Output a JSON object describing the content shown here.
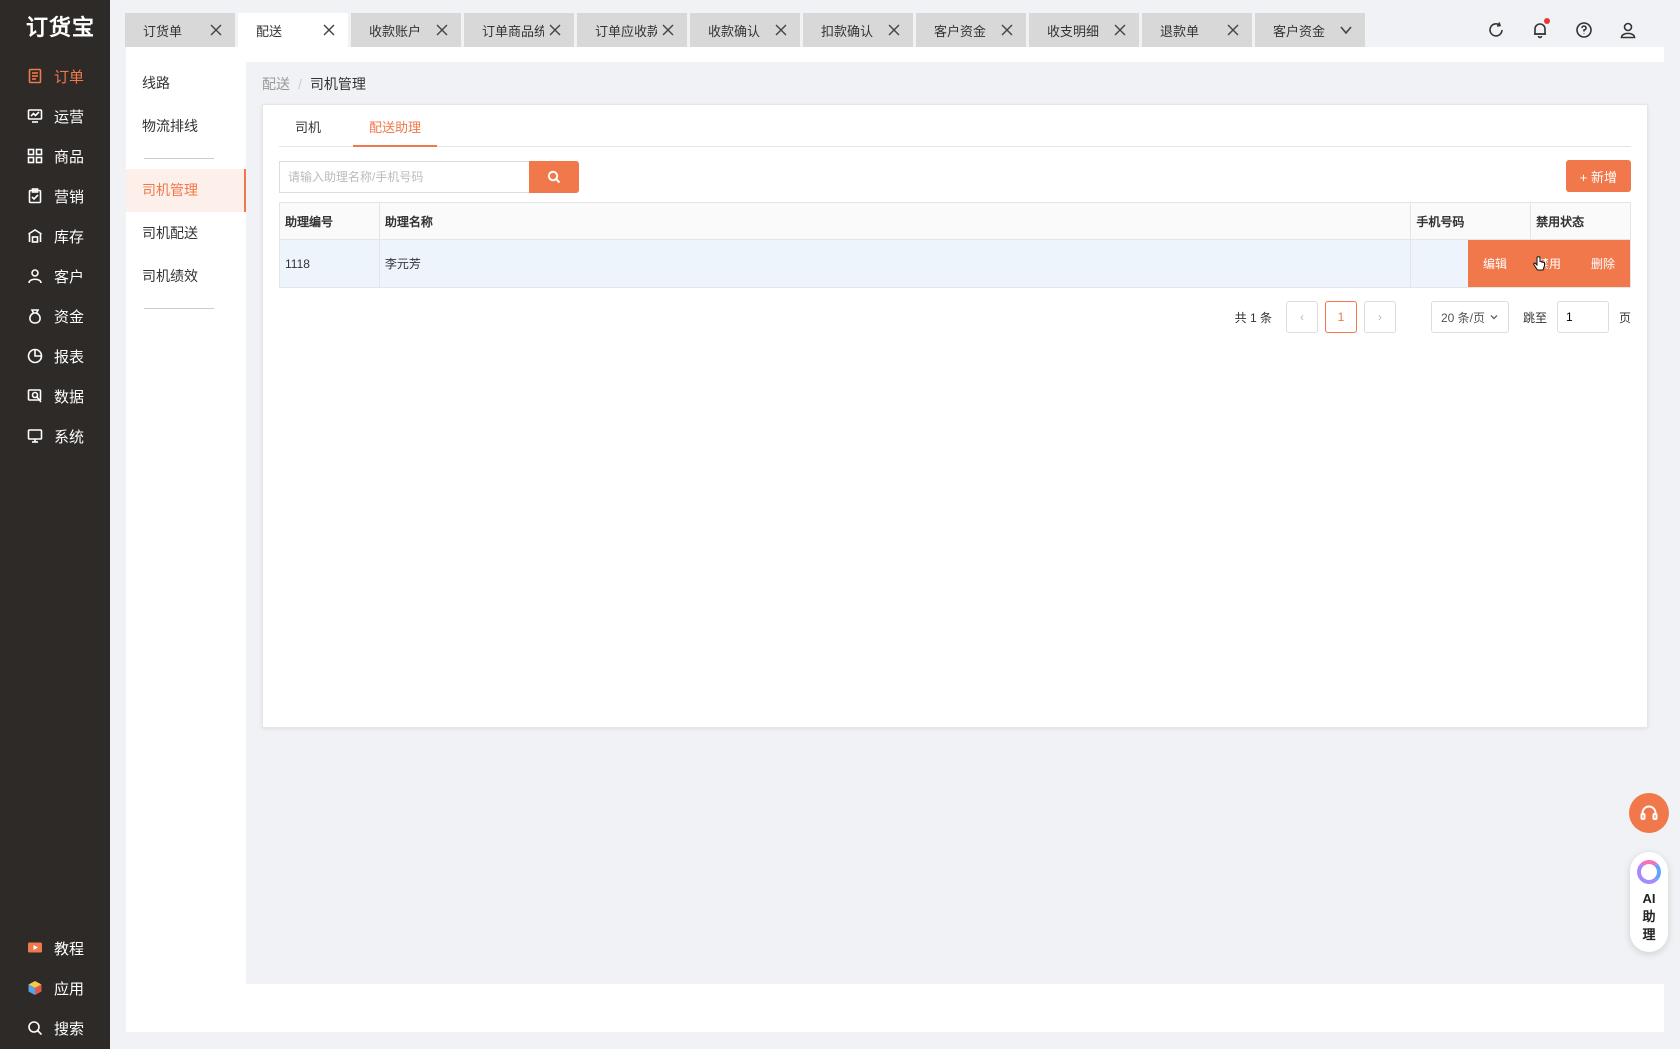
{
  "app": {
    "logo": "订货宝"
  },
  "sidebar": {
    "items": [
      {
        "label": "订单",
        "icon": "order-icon",
        "active": true
      },
      {
        "label": "运营",
        "icon": "operation-icon"
      },
      {
        "label": "商品",
        "icon": "goods-icon"
      },
      {
        "label": "营销",
        "icon": "marketing-icon"
      },
      {
        "label": "库存",
        "icon": "warehouse-icon"
      },
      {
        "label": "客户",
        "icon": "customer-icon"
      },
      {
        "label": "资金",
        "icon": "money-bag-icon"
      },
      {
        "label": "报表",
        "icon": "pie-chart-icon"
      },
      {
        "label": "数据",
        "icon": "data-icon"
      },
      {
        "label": "系统",
        "icon": "monitor-icon"
      }
    ],
    "bottom": [
      {
        "label": "教程",
        "icon": "video-icon"
      },
      {
        "label": "应用",
        "icon": "cube-icon"
      },
      {
        "label": "搜索",
        "icon": "search-icon"
      }
    ]
  },
  "tabs": [
    {
      "label": "订货单"
    },
    {
      "label": "配送",
      "active": true
    },
    {
      "label": "收款账户"
    },
    {
      "label": "订单商品统计"
    },
    {
      "label": "订单应收款"
    },
    {
      "label": "收款确认"
    },
    {
      "label": "扣款确认"
    },
    {
      "label": "客户资金"
    },
    {
      "label": "收支明细"
    },
    {
      "label": "退款单"
    },
    {
      "label": "客户资金"
    }
  ],
  "subnav": {
    "group1": [
      "线路",
      "物流排线"
    ],
    "group2": [
      "司机管理",
      "司机配送",
      "司机绩效"
    ],
    "active": "司机管理"
  },
  "breadcrumb": {
    "parent": "配送",
    "current": "司机管理"
  },
  "inner_tabs": [
    {
      "label": "司机"
    },
    {
      "label": "配送助理",
      "active": true
    }
  ],
  "search": {
    "placeholder": "请输入助理名称/手机号码",
    "value": ""
  },
  "add_button": "+ 新增",
  "table": {
    "columns": [
      "助理编号",
      "助理名称",
      "手机号码",
      "禁用状态"
    ],
    "rows": [
      {
        "id": "1118",
        "name": "李元芳",
        "phone": "",
        "status": ""
      }
    ],
    "row_actions": [
      "编辑",
      "禁用",
      "删除"
    ]
  },
  "pagination": {
    "total": "共 1 条",
    "current": "1",
    "page_size": "20 条/页",
    "jump_label": "跳至",
    "jump_value": "1",
    "page_suffix": "页"
  },
  "float": {
    "ai_label": "AI助理"
  },
  "colors": {
    "accent": "#f0784a",
    "sidebar": "#2d2a28"
  }
}
